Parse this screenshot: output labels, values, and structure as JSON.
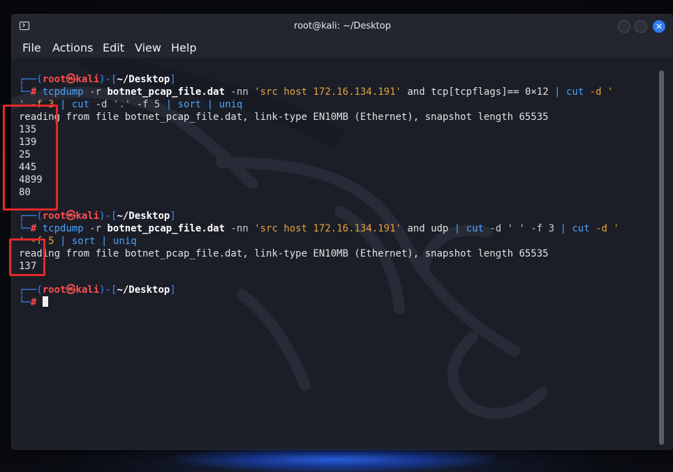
{
  "window": {
    "title": "root@kali: ~/Desktop"
  },
  "menu": [
    "File",
    "Actions",
    "Edit",
    "View",
    "Help"
  ],
  "prompt": {
    "user": "root",
    "at": "㉿",
    "host": "kali",
    "path": "~/Desktop",
    "symbol": "#"
  },
  "session1": {
    "cmd_line1": {
      "p1": "tcpdump",
      "p2": " -r ",
      "p3": "botnet_pcap_file.dat",
      "p4": " -nn ",
      "p5": "'src host 172.16.134.191'",
      "p6": " and tcp",
      "p7": "[tcpflags]",
      "p8": "== 0×12",
      "p9": " | ",
      "p10": "cut",
      "p11": " -d '"
    },
    "cmd_line2": {
      "p1": "' -f 3 ",
      "p2": "| ",
      "p3": "cut",
      "p4": " -d ",
      "p5": "'.'",
      "p6": " -f 5 ",
      "p7": "| ",
      "p8": "sort",
      "p9": " | ",
      "p10": "uniq"
    },
    "reading": "reading from file botnet_pcap_file.dat, link-type EN10MB (Ethernet), snapshot length 65535",
    "ports": [
      "135",
      "139",
      "25",
      "445",
      "4899",
      "80"
    ]
  },
  "session2": {
    "cmd_line1": {
      "p1": "tcpdump",
      "p2": " -r ",
      "p3": "botnet_pcap_file.dat",
      "p4": " -nn ",
      "p5": "'src host 172.16.134.191'",
      "p6": " and udp ",
      "p7": "| ",
      "p8": "cut",
      "p9": " -d ' ' -f 3 ",
      "p10": "| ",
      "p11": "cut",
      "p12": " -d '"
    },
    "cmd_line2": {
      "p1": "' -f 5 ",
      "p2": "| ",
      "p3": "sort",
      "p4": " | ",
      "p5": "uniq"
    },
    "reading": "reading from file botnet_pcap_file.dat, link-type EN10MB (Ethernet), snapshot length 65535",
    "ports": [
      "137"
    ]
  },
  "colors": {
    "prompt_frame": "#3f8cff",
    "prompt_user": "#ff4f4f",
    "string": "#e9a23b",
    "command": "#4aa3ff",
    "annotation": "#e62a2a"
  },
  "icons": {
    "terminal": "terminal-icon",
    "close": "close-icon"
  }
}
